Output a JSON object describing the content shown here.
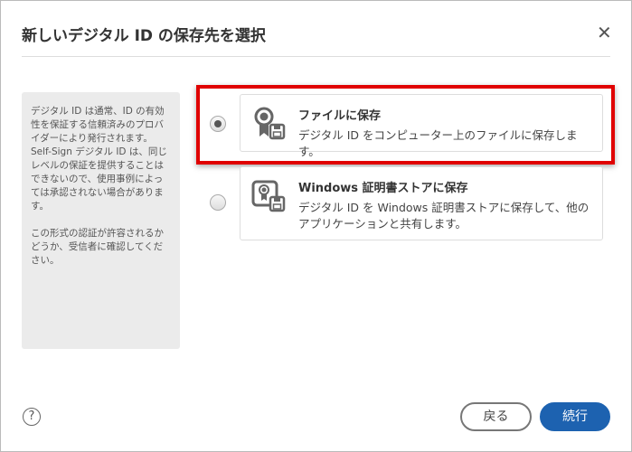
{
  "dialog": {
    "title": "新しいデジタル ID の保存先を選択",
    "close_icon": "close-icon"
  },
  "info": {
    "paragraph1": "デジタル ID は通常、ID の有効性を保証する信頼済みのプロバイダーにより発行されます。Self-Sign デジタル ID は、同じレベルの保証を提供することはできないので、使用事例によっては承認されない場合があります。",
    "paragraph2": "この形式の認証が許容されるかどうか、受信者に確認してください。"
  },
  "options": [
    {
      "title": "ファイルに保存",
      "description": "デジタル ID をコンピューター上のファイルに保存します。",
      "selected": true,
      "icon": "certificate-save-icon"
    },
    {
      "title": "Windows 証明書ストアに保存",
      "description": "デジタル ID を Windows 証明書ストアに保存して、他のアプリケーションと共有します。",
      "selected": false,
      "icon": "certificate-store-save-icon"
    }
  ],
  "footer": {
    "help": "?",
    "back": "戻る",
    "continue": "続行"
  },
  "colors": {
    "accent": "#1d62b0",
    "highlight": "#e00000"
  }
}
